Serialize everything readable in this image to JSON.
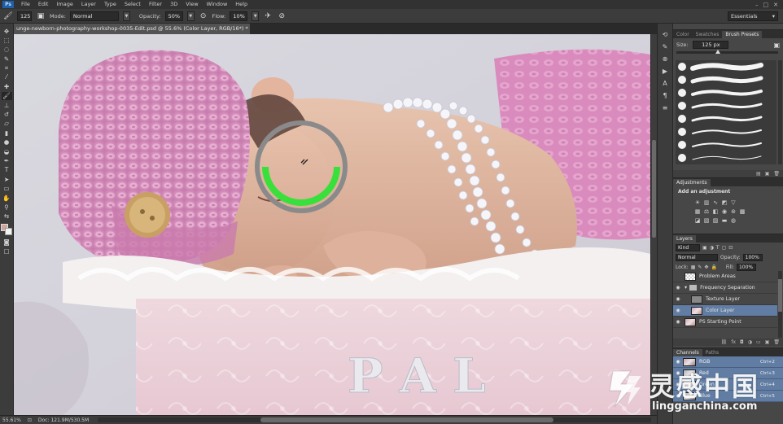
{
  "menubar": {
    "logo": "Ps",
    "items": [
      "File",
      "Edit",
      "Image",
      "Layer",
      "Type",
      "Select",
      "Filter",
      "3D",
      "View",
      "Window",
      "Help"
    ],
    "controls": [
      "–",
      "□",
      "✕"
    ]
  },
  "options": {
    "brush_size": "125",
    "mode_label": "Mode:",
    "mode_value": "Normal",
    "opacity_label": "Opacity:",
    "opacity_value": "50%",
    "flow_label": "Flow:",
    "flow_value": "10%",
    "workspace": "Essentials"
  },
  "document": {
    "tab_title": "unge-newborn-photography-workshop-0035-Edit.psd @ 55.6% (Color Layer, RGB/16*) *",
    "close": "×"
  },
  "canvas": {
    "crate_text": "P A L"
  },
  "statusbar": {
    "zoom": "55.61%",
    "doc": "Doc: 121.9M/530.5M"
  },
  "brush_panel": {
    "tabs": [
      "Color",
      "Swatches",
      "Brush Presets"
    ],
    "size_label": "Size:",
    "size_value": "125 px",
    "brushes": [
      {
        "thick": 6
      },
      {
        "thick": 5
      },
      {
        "thick": 4
      },
      {
        "thick": 3
      },
      {
        "thick": 3
      },
      {
        "thick": 2
      },
      {
        "thick": 2
      },
      {
        "thick": 1
      }
    ]
  },
  "adjustments": {
    "title": "Adjustments",
    "hint": "Add an adjustment"
  },
  "layers": {
    "title": "Layers",
    "kind_label": "Kind",
    "blend": "Normal",
    "opacity_label": "Opacity:",
    "opacity_value": "100%",
    "lock_label": "Lock:",
    "fill_label": "Fill:",
    "fill_value": "100%",
    "items": [
      {
        "name": "Problem Areas",
        "thumb": "check",
        "eye": "",
        "indent": 0,
        "selected": false,
        "folder": false
      },
      {
        "name": "Frequency Separation",
        "thumb": "",
        "eye": "👁",
        "indent": 0,
        "selected": false,
        "folder": true
      },
      {
        "name": "Texture Layer",
        "thumb": "gray",
        "eye": "👁",
        "indent": 1,
        "selected": false,
        "folder": false
      },
      {
        "name": "Color Layer",
        "thumb": "photo",
        "eye": "👁",
        "indent": 1,
        "selected": true,
        "folder": false
      },
      {
        "name": "PS Starting Point",
        "thumb": "photo",
        "eye": "👁",
        "indent": 0,
        "selected": false,
        "folder": false
      }
    ]
  },
  "channels": {
    "tabs": [
      "Channels",
      "Paths"
    ],
    "items": [
      {
        "name": "RGB",
        "shortcut": "Ctrl+2",
        "gray": false
      },
      {
        "name": "Red",
        "shortcut": "Ctrl+3",
        "gray": true
      },
      {
        "name": "Green",
        "shortcut": "Ctrl+4",
        "gray": true
      },
      {
        "name": "Blue",
        "shortcut": "Ctrl+5",
        "gray": true
      }
    ]
  },
  "watermark": {
    "chinese": "灵感中国",
    "english": "lingganchina.com"
  }
}
